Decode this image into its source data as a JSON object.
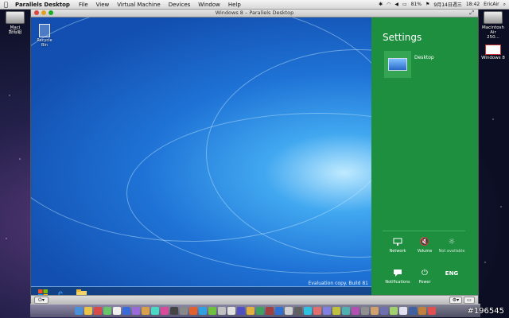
{
  "menubar": {
    "app": "Parallels Desktop",
    "items": [
      "File",
      "View",
      "Virtual Machine",
      "Devices",
      "Window",
      "Help"
    ],
    "battery": "81%",
    "date": "9月14日週三",
    "time": "18:42",
    "user": "EricAir"
  },
  "desktop": {
    "left_icon": "Maci",
    "left_icon_sub": "設有組",
    "right_icon": "Macintosh Air",
    "right_icon_sub": "250...",
    "right_icon2": "Windows 8"
  },
  "vm": {
    "title": "Windows 8 – Parallels Desktop",
    "recycle_bin": "Recycle Bin",
    "eval_text": "Evaluation copy. Build 81",
    "settings": {
      "title": "Settings",
      "tile_label": "Desktop",
      "quick": [
        {
          "label": "Network",
          "icon": "network-icon"
        },
        {
          "label": "Volume",
          "icon": "volume-muted-icon"
        },
        {
          "label": "Not available",
          "icon": "brightness-icon"
        },
        {
          "label": "Notifications",
          "icon": "notifications-icon"
        },
        {
          "label": "Power",
          "icon": "power-icon"
        },
        {
          "label": "ENG",
          "icon": "keyboard-icon"
        }
      ]
    }
  },
  "dock_colors": [
    "#4a90d9",
    "#e8c44a",
    "#d84a4a",
    "#6ac46a",
    "#f0f0f0",
    "#3a6ad8",
    "#9a6ad8",
    "#d8a04a",
    "#4ad8c4",
    "#d84a9a",
    "#444",
    "#888",
    "#e06030",
    "#30a0e0",
    "#70c040",
    "#c0c0c0",
    "#e0e0e0",
    "#5050c0",
    "#e0b040",
    "#40a060",
    "#a04040",
    "#3070d0",
    "#d0d0d0",
    "#606060",
    "#30c0e0",
    "#e07070",
    "#8080e0",
    "#c0c040",
    "#50b0b0",
    "#b050b0",
    "#909090",
    "#d0a070",
    "#7070b0",
    "#a0d070",
    "#e0e0f0",
    "#4060a0",
    "#c08040",
    "#e05050"
  ],
  "watermark": "#196545"
}
